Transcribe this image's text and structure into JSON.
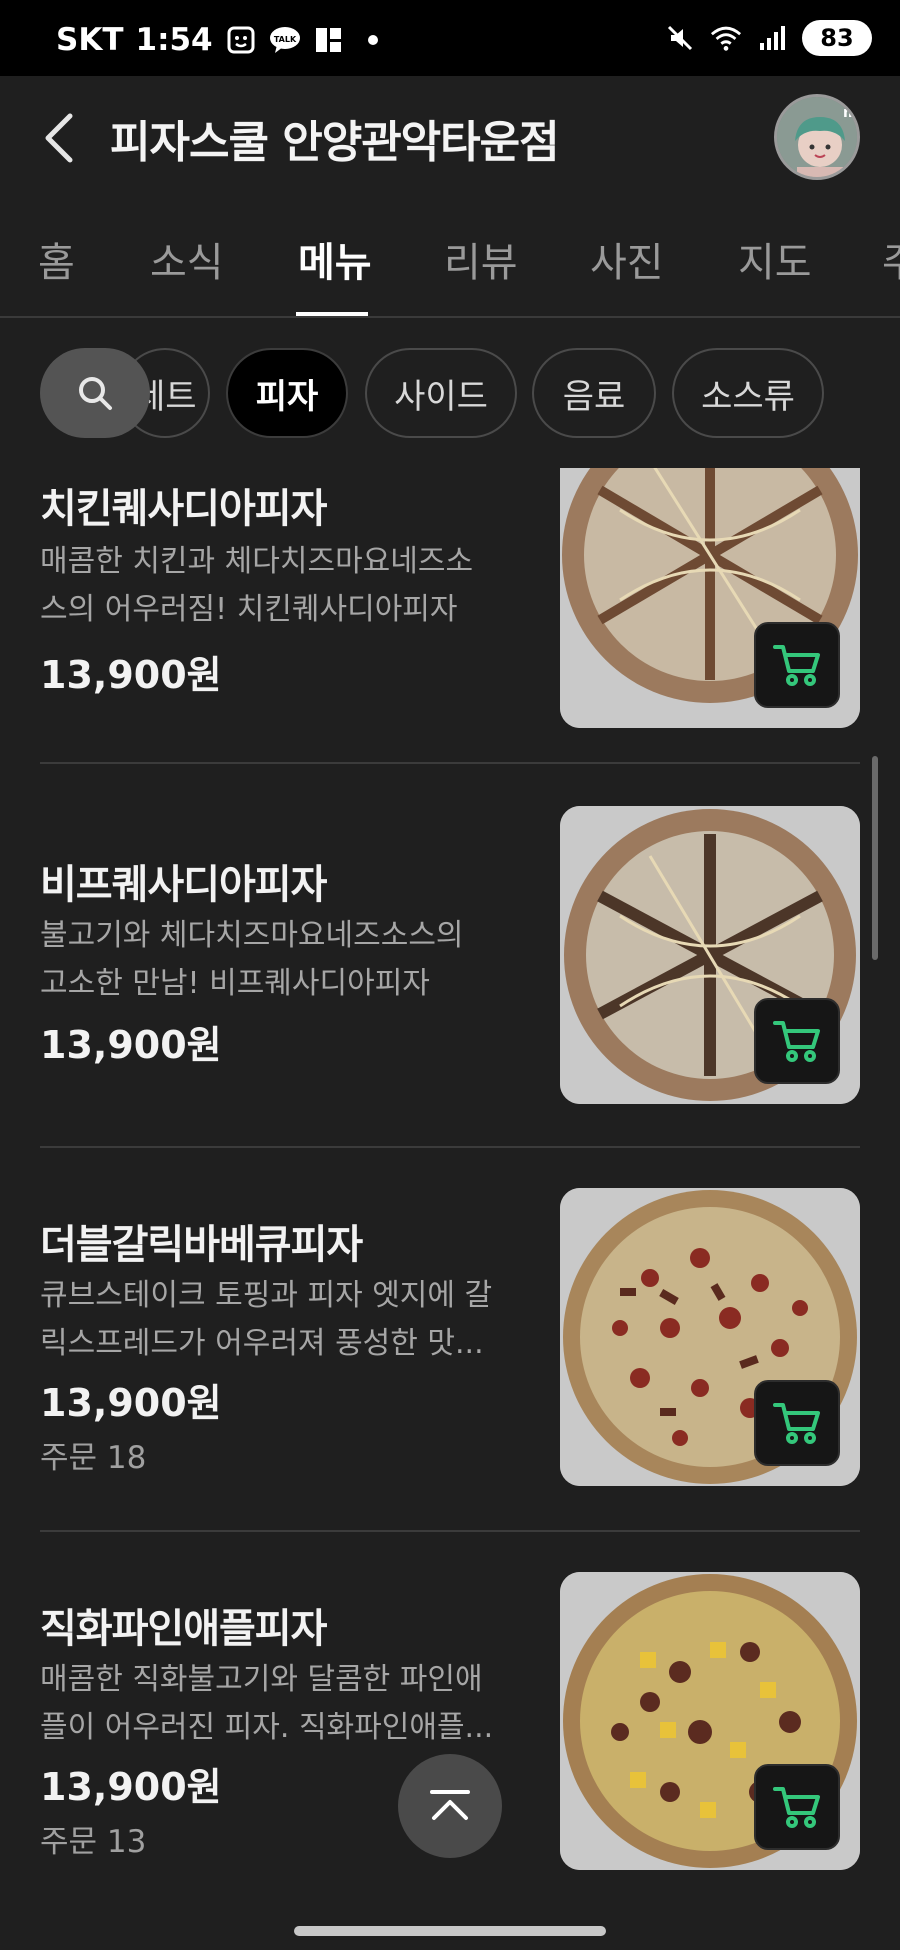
{
  "status_bar": {
    "carrier": "SKT",
    "time": "1:54",
    "battery": "83"
  },
  "header": {
    "title": "피자스쿨 안양관악타운점"
  },
  "tabs": [
    {
      "label": "홈"
    },
    {
      "label": "소식"
    },
    {
      "label": "메뉴"
    },
    {
      "label": "리뷰"
    },
    {
      "label": "사진"
    },
    {
      "label": "지도"
    },
    {
      "label": "주"
    }
  ],
  "active_tab": "메뉴",
  "categories": {
    "partial_label": "세트",
    "items": [
      "피자",
      "사이드",
      "음료",
      "소스류"
    ],
    "selected": "피자"
  },
  "menu_items": [
    {
      "name": "치킨퀘사디아피자",
      "desc_line1": "매콤한 치킨과 체다치즈마요네즈소",
      "desc_line2": "스의 어우러짐! 치킨퀘사디아피자",
      "price": "13,900원"
    },
    {
      "name": "비프퀘사디아피자",
      "desc_line1": "불고기와 체다치즈마요네즈소스의",
      "desc_line2": "고소한 만남! 비프퀘사디아피자",
      "price": "13,900원"
    },
    {
      "name": "더블갈릭바베큐피자",
      "desc_line1": "큐브스테이크 토핑과 피자 엣지에 갈",
      "desc_line2": "릭스프레드가 어우러져 풍성한 맛...",
      "price": "13,900원",
      "orders": "주문 18"
    },
    {
      "name": "직화파인애플피자",
      "desc_line1": "매콤한 직화불고기와 달콤한 파인애",
      "desc_line2": "플이 어우러진 피자. 직화파인애플...",
      "price": "13,900원",
      "orders": "주문 13"
    }
  ],
  "colors": {
    "background": "#1f1f1f",
    "cart_icon": "#34c77b",
    "text_primary": "#f2f2f2",
    "text_secondary": "#a6a6a6"
  },
  "icons": {
    "back": "chevron-left-icon",
    "search": "search-icon",
    "cart": "cart-icon",
    "scroll_top": "chevron-up-icon"
  }
}
